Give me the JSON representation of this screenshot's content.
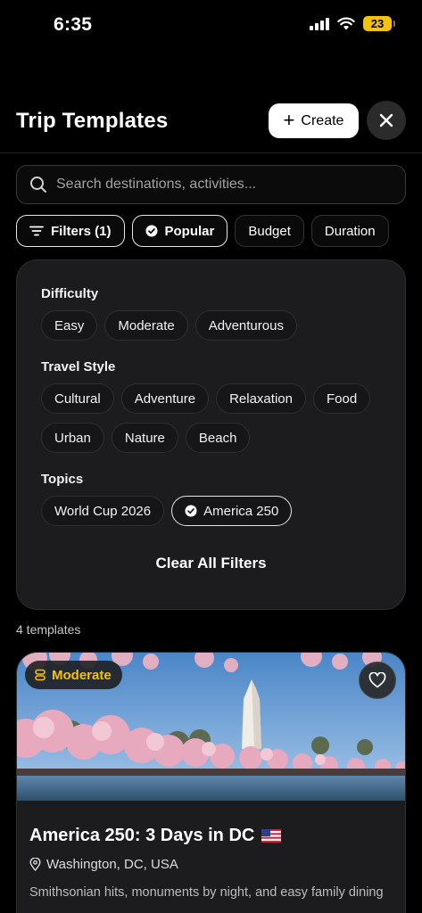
{
  "status_bar": {
    "time": "6:35",
    "battery": "23",
    "battery_color": "#f4c20d"
  },
  "header": {
    "title": "Trip Templates",
    "create_label": "Create",
    "create_icon": "plus-icon",
    "close_icon": "close-icon"
  },
  "search": {
    "placeholder": "Search destinations, activities...",
    "value": "",
    "icon": "search-icon"
  },
  "filter_chips": [
    {
      "label": "Filters (1)",
      "icon": "filter-lines-icon",
      "selected": true
    },
    {
      "label": "Popular",
      "icon": "check-circle-icon",
      "selected": true
    },
    {
      "label": "Budget",
      "selected": false
    },
    {
      "label": "Duration",
      "selected": false
    }
  ],
  "filter_panel": {
    "difficulty": {
      "label": "Difficulty",
      "options": [
        "Easy",
        "Moderate",
        "Adventurous"
      ]
    },
    "travel_style": {
      "label": "Travel Style",
      "options": [
        "Cultural",
        "Adventure",
        "Relaxation",
        "Food",
        "Urban",
        "Nature",
        "Beach"
      ]
    },
    "topics": {
      "label": "Topics",
      "options": [
        {
          "label": "World Cup 2026",
          "selected": false
        },
        {
          "label": "America 250",
          "selected": true
        }
      ]
    },
    "clear_label": "Clear All Filters"
  },
  "results": {
    "count_label": "4 templates"
  },
  "cards": [
    {
      "difficulty": "Moderate",
      "difficulty_icon": "difficulty-stack-icon",
      "favorite_icon": "heart-icon",
      "title": "America 250: 3 Days in DC",
      "flag_icon": "us-flag-icon",
      "location": "Washington, DC, USA",
      "location_icon": "map-pin-icon",
      "description": "Smithsonian hits, monuments by night, and easy family dining"
    }
  ],
  "colors": {
    "accent_yellow": "#f4c20d",
    "panel_bg": "#1c1c1e",
    "background": "#000000"
  }
}
